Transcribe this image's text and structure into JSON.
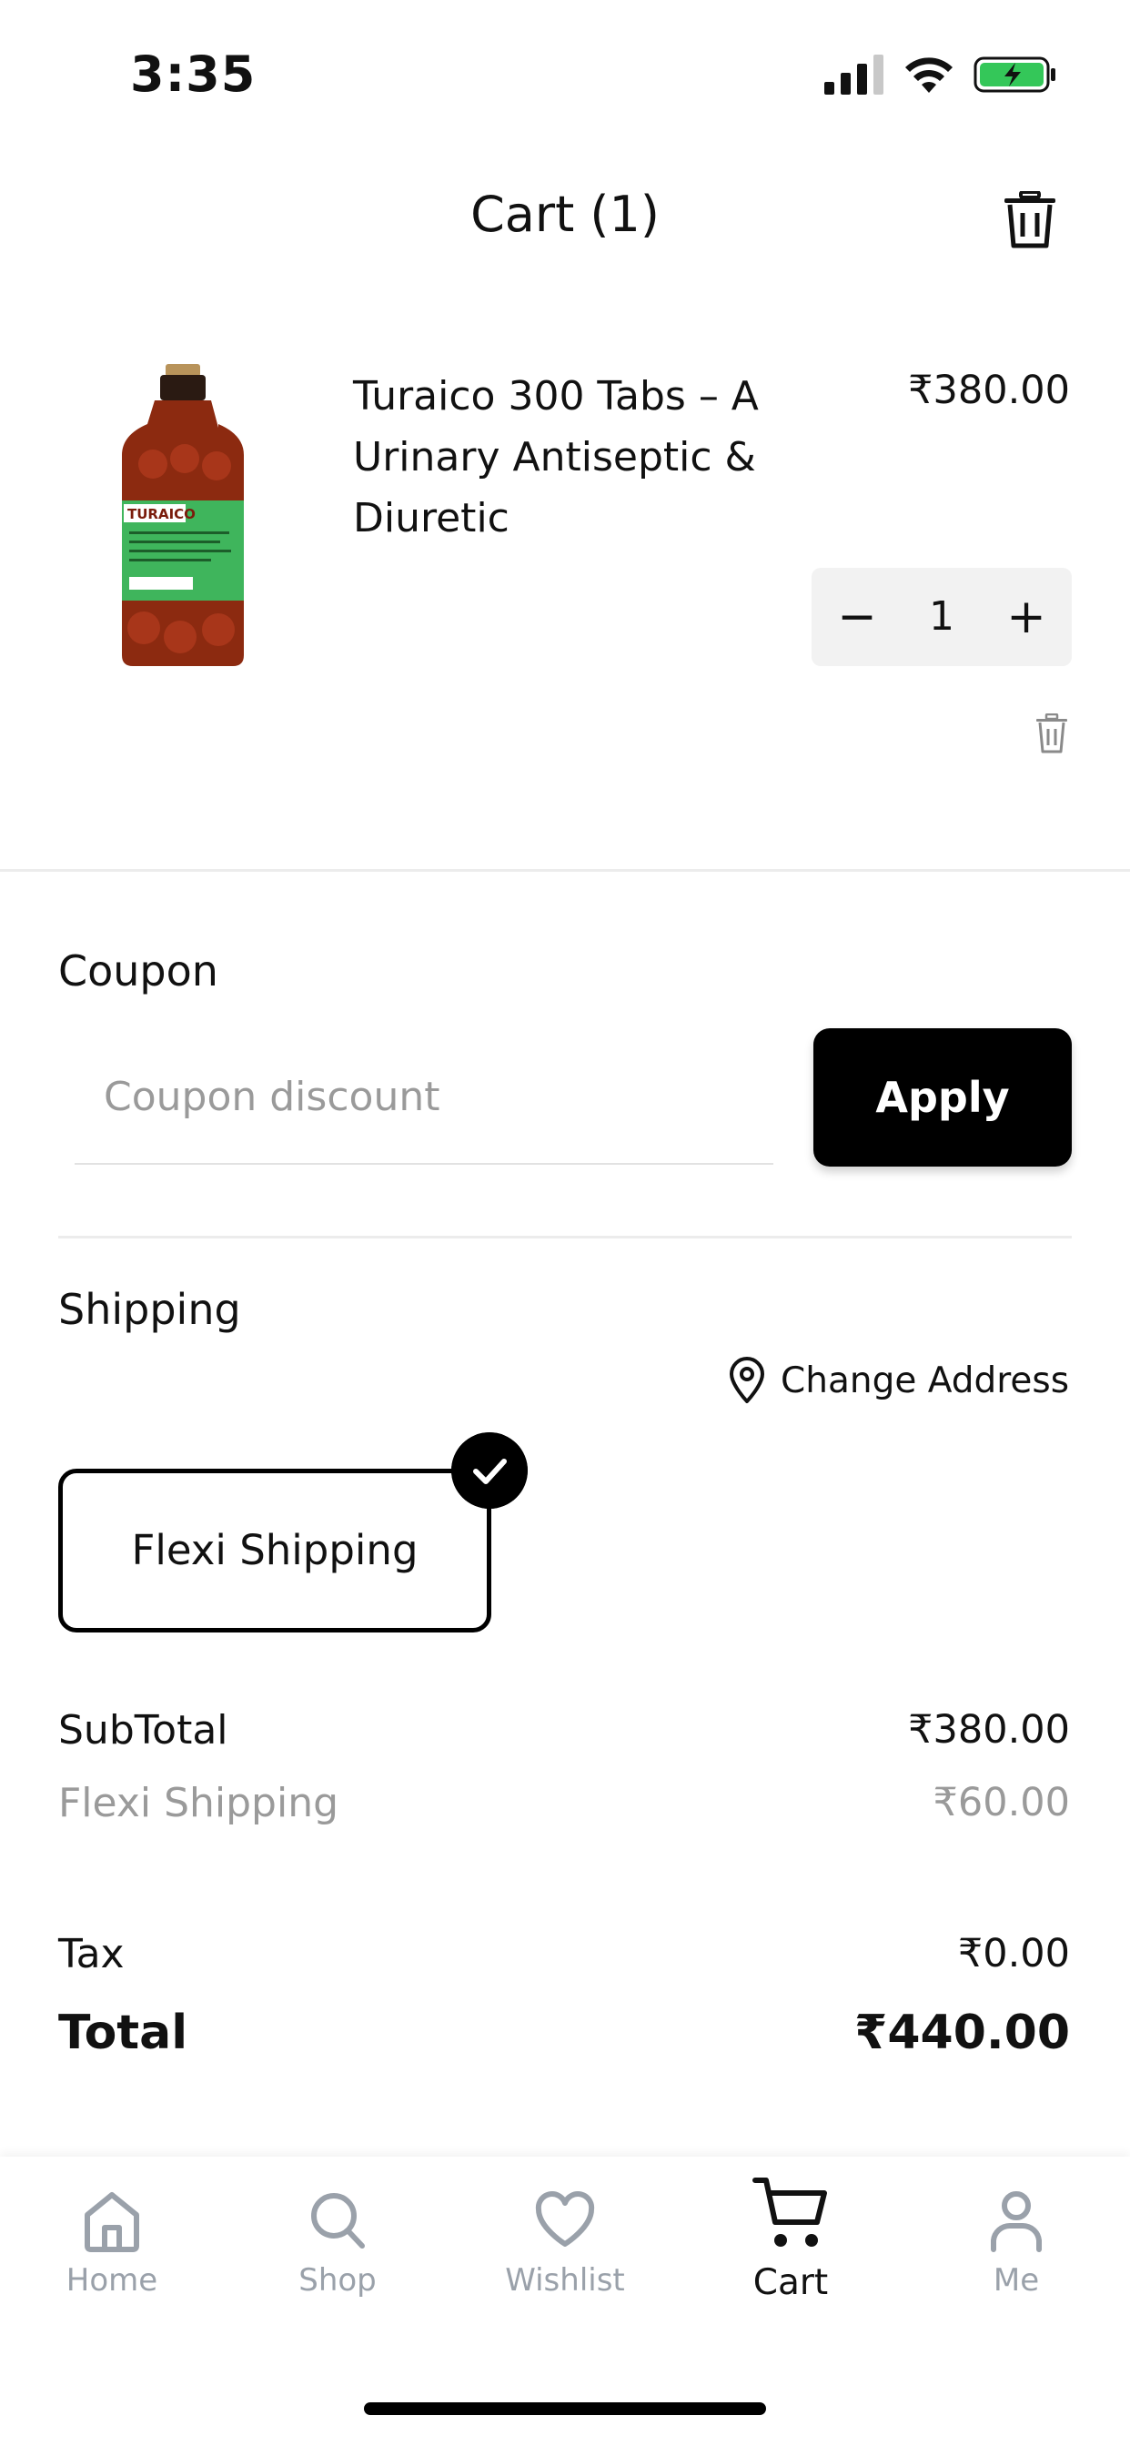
{
  "status_bar": {
    "time": "3:35"
  },
  "header": {
    "title": "Cart (1)"
  },
  "cart_item": {
    "name": "Turaico 300 Tabs – A Urinary Antiseptic & Diuretic",
    "price": "₹380.00",
    "quantity": "1",
    "qty_minus": "−",
    "qty_plus": "+",
    "label_text": "TURAICO"
  },
  "coupon": {
    "title": "Coupon",
    "placeholder": "Coupon discount",
    "apply_label": "Apply"
  },
  "shipping": {
    "title": "Shipping",
    "change_address_label": "Change Address",
    "option_label": "Flexi Shipping"
  },
  "totals": {
    "subtotal_label": "SubTotal",
    "subtotal_value": "₹380.00",
    "shipping_label": "Flexi Shipping",
    "shipping_value": "₹60.00",
    "tax_label": "Tax",
    "tax_value": "₹0.00",
    "total_label": "Total",
    "total_value": "₹440.00"
  },
  "bottom_nav": {
    "items": [
      {
        "label": "Home",
        "icon": "home-icon"
      },
      {
        "label": "Shop",
        "icon": "search-icon"
      },
      {
        "label": "Wishlist",
        "icon": "heart-icon"
      },
      {
        "label": "Cart",
        "icon": "cart-icon"
      },
      {
        "label": "Me",
        "icon": "user-icon"
      }
    ],
    "active": "Cart"
  },
  "colors": {
    "primary": "#000000",
    "muted": "#9a9a9a",
    "battery": "#34c759",
    "nav_inactive": "#9aa1aa"
  }
}
